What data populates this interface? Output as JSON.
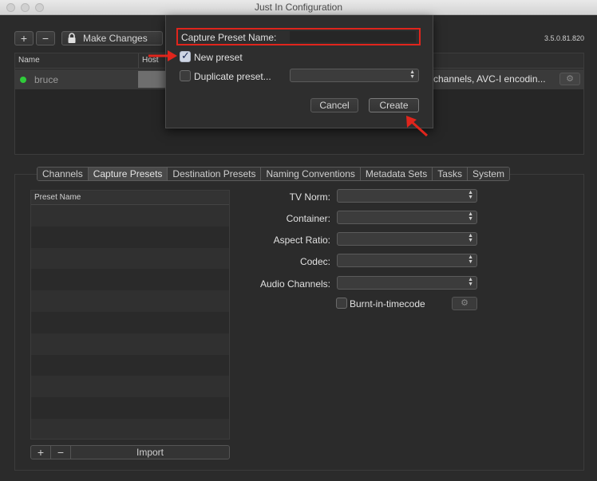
{
  "window": {
    "title": "Just In Configuration"
  },
  "toolbar": {
    "add_label": "+",
    "remove_label": "−",
    "make_changes_label": "Make Changes",
    "version": "3.5.0.81.820"
  },
  "top_table": {
    "columns": [
      "Name",
      "Host"
    ],
    "rows": [
      {
        "name": "bruce",
        "description": "channels, AVC-I encodin..."
      }
    ]
  },
  "tabs": [
    {
      "label": "Channels"
    },
    {
      "label": "Capture Presets",
      "active": true
    },
    {
      "label": "Destination Presets"
    },
    {
      "label": "Naming Conventions"
    },
    {
      "label": "Metadata Sets"
    },
    {
      "label": "Tasks"
    },
    {
      "label": "System"
    }
  ],
  "preset_list": {
    "header": "Preset Name",
    "add_label": "+",
    "remove_label": "−",
    "import_label": "Import"
  },
  "form": {
    "tv_norm_label": "TV Norm:",
    "container_label": "Container:",
    "aspect_ratio_label": "Aspect Ratio:",
    "codec_label": "Codec:",
    "audio_channels_label": "Audio Channels:",
    "burnt_in_label": "Burnt-in-timecode"
  },
  "dialog": {
    "name_label": "Capture Preset Name:",
    "name_value": "",
    "new_preset_label": "New preset",
    "new_preset_checked": true,
    "duplicate_label": "Duplicate preset...",
    "cancel_label": "Cancel",
    "create_label": "Create"
  },
  "colors": {
    "annotation": "#e0251c",
    "status_online": "#2fcc3a",
    "background": "#2b2b2b"
  },
  "icons": {
    "lock": "lock-icon",
    "gear": "gear-icon",
    "status": "status-dot-icon"
  }
}
